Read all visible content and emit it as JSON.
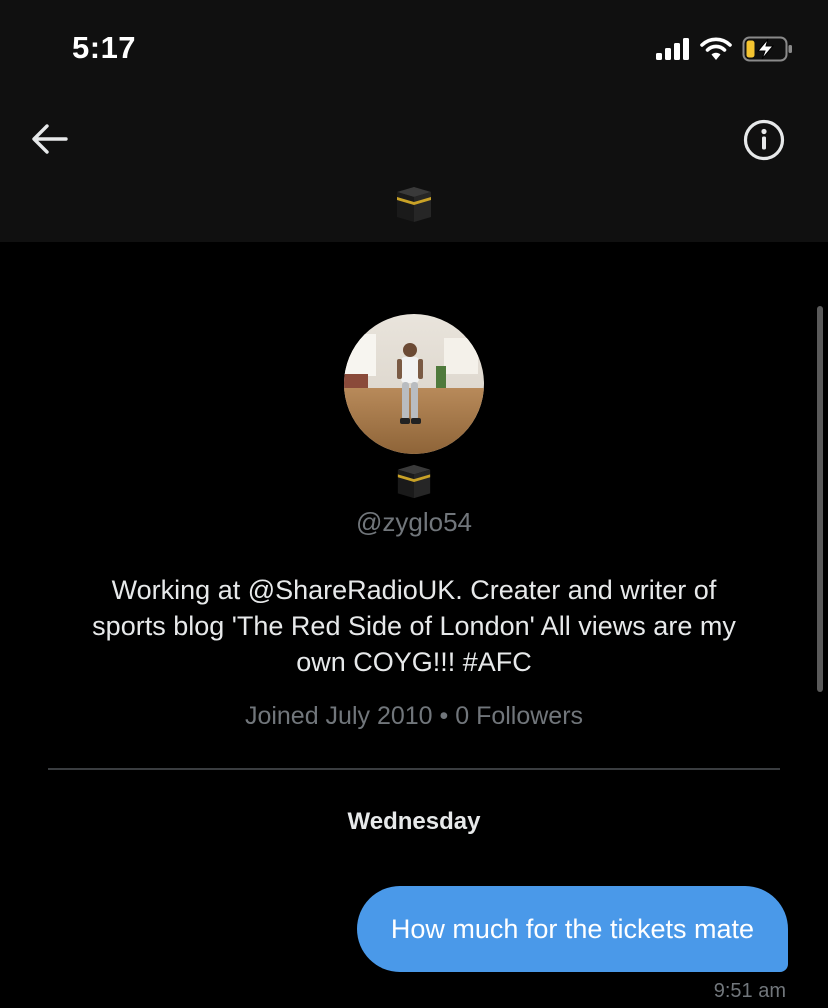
{
  "status_bar": {
    "time": "5:17",
    "icons": [
      "signal-icon",
      "wifi-icon",
      "battery-charging-icon"
    ],
    "battery_color": "#f4c430"
  },
  "header": {
    "back_icon": "arrow-left-icon",
    "info_icon": "info-circle-icon",
    "name_icon": "kaaba-emoji-icon"
  },
  "profile": {
    "avatar_icon": "profile-photo",
    "name_icon": "kaaba-emoji-icon",
    "handle": "@zyglo54",
    "bio_line_1": "Working at @ShareRadioUK. Creater and writer of",
    "bio_line_2": "sports blog 'The Red Side of London'  All views are my",
    "bio_line_3": "own COYG!!! #AFC",
    "meta": "Joined July 2010 • 0 Followers"
  },
  "conversation": {
    "day_label": "Wednesday",
    "messages": [
      {
        "text": "How much for the tickets mate",
        "time": "9:51 am",
        "sender": "self"
      }
    ]
  },
  "colors": {
    "background": "#000000",
    "header_bg": "#101010",
    "bubble": "#4a99e9",
    "secondary_text": "#71767b",
    "primary_text": "#e7e9ea"
  }
}
